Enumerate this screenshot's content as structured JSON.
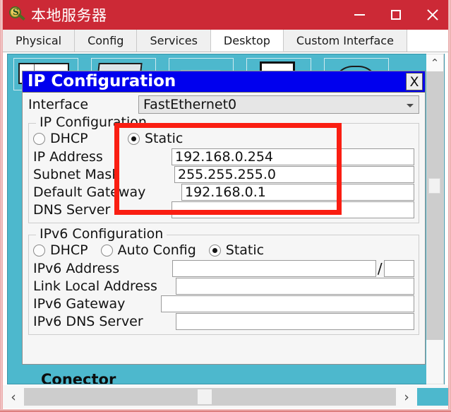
{
  "window": {
    "title": "本地服务器",
    "icon": "packet-tracer-icon",
    "controls": {
      "minimize": "–",
      "maximize": "□",
      "close": "✕"
    },
    "accent_color": "#cc2936"
  },
  "tabs": [
    {
      "label": "Physical",
      "active": false
    },
    {
      "label": "Config",
      "active": false
    },
    {
      "label": "Services",
      "active": false
    },
    {
      "label": "Desktop",
      "active": true
    },
    {
      "label": "Custom Interface",
      "active": false
    }
  ],
  "desktop": {
    "background_color": "#4db8cd",
    "partial_label": "Conector"
  },
  "dialog": {
    "title": "IP Configuration",
    "close_label": "X",
    "interface": {
      "label": "Interface",
      "value": "FastEthernet0"
    },
    "ipv4": {
      "legend": "IP Configuration",
      "modes": [
        {
          "label": "DHCP",
          "selected": false
        },
        {
          "label": "Static",
          "selected": true
        }
      ],
      "fields": [
        {
          "label": "IP Address",
          "value": "192.168.0.254"
        },
        {
          "label": "Subnet Mask",
          "value": "255.255.255.0"
        },
        {
          "label": "Default Gateway",
          "value": "192.168.0.1"
        },
        {
          "label": "DNS Server",
          "value": ""
        }
      ]
    },
    "ipv6": {
      "legend": "IPv6 Configuration",
      "modes": [
        {
          "label": "DHCP",
          "selected": false
        },
        {
          "label": "Auto Config",
          "selected": false
        },
        {
          "label": "Static",
          "selected": true
        }
      ],
      "fields": [
        {
          "label": "IPv6 Address",
          "value": "",
          "prefix": "",
          "separator": "/"
        },
        {
          "label": "Link Local Address",
          "value": ""
        },
        {
          "label": "IPv6 Gateway",
          "value": ""
        },
        {
          "label": "IPv6 DNS Server",
          "value": ""
        }
      ]
    }
  },
  "annotation": {
    "color": "#fa1e12",
    "shape": "rectangle"
  },
  "scrollbars": {
    "vertical": {
      "up_arrow": "⌃"
    },
    "horizontal": {
      "left_arrow": "‹",
      "right_arrow": "›"
    }
  }
}
